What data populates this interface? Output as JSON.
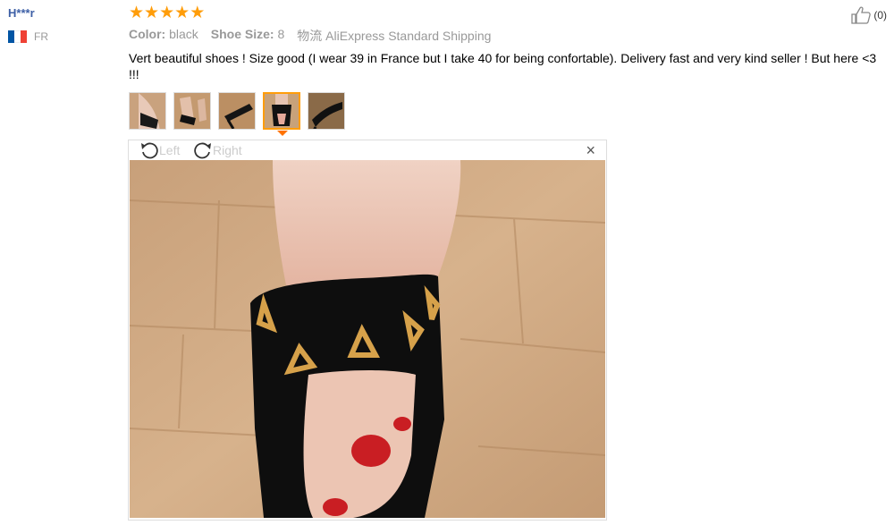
{
  "reviewer": {
    "name": "H***r",
    "country_code": "FR",
    "flag_colors": [
      "#0055a4",
      "#ffffff",
      "#ef4135"
    ]
  },
  "rating": {
    "stars": 5,
    "max": 5,
    "star_color": "#ff9d0a"
  },
  "helpful": {
    "icon": "thumbs-up-icon",
    "count": "(0)"
  },
  "attributes": {
    "color_label": "Color:",
    "color_value": "black",
    "size_label": "Shoe Size:",
    "size_value": "8",
    "shipping_label": "物流",
    "shipping_value": "AliExpress Standard Shipping"
  },
  "review": {
    "text": "Vert beautiful shoes ! Size good (I wear 39 in France but I take 40 for being confortable). Delivery fast and very kind seller ! But here <3 !!!"
  },
  "photos": {
    "count": 5,
    "selected_index": 3
  },
  "viewer": {
    "rotate_left": "Left",
    "rotate_right": "Right",
    "close": "×"
  },
  "colors": {
    "accent": "#ff9d0a",
    "username": "#3d5fa6"
  }
}
